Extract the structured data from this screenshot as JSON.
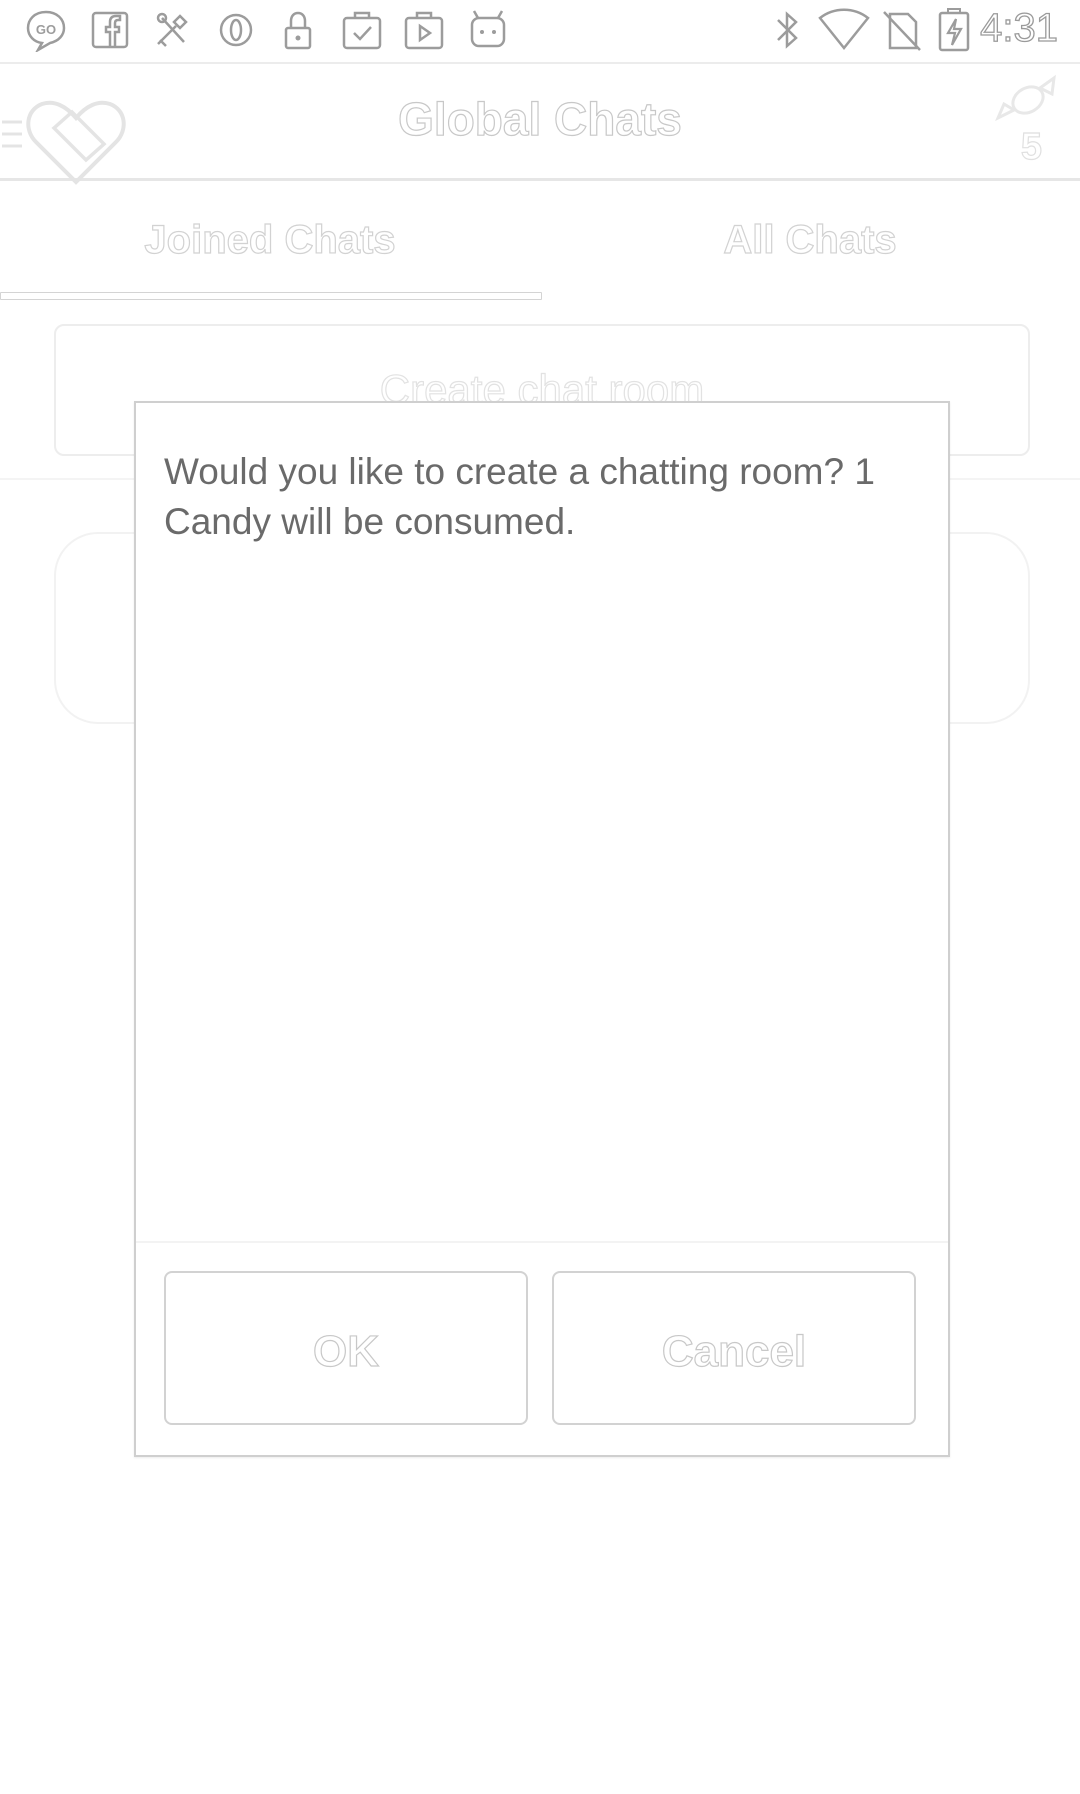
{
  "status_bar": {
    "time": "4:31",
    "left_icons": [
      "go-sms-icon",
      "facebook-icon",
      "tools-icon",
      "opera-icon",
      "lock-icon",
      "clipboard-check-icon",
      "play-bag-icon",
      "android-icon"
    ],
    "right_icons": [
      "bluetooth-icon",
      "wifi-icon",
      "no-sim-icon",
      "battery-charging-icon"
    ]
  },
  "header": {
    "title": "Global Chats",
    "candy_count": "5"
  },
  "tabs": [
    {
      "label": "Joined Chats",
      "selected": true
    },
    {
      "label": "All Chats",
      "selected": false
    }
  ],
  "main": {
    "create_button_label": "Create chat room"
  },
  "dialog": {
    "message": "Would you like to create a chatting room? 1 Candy will be consumed.",
    "ok_label": "OK",
    "cancel_label": "Cancel"
  },
  "colors": {
    "outline": "#c8c8c8",
    "dialog_text": "#6a6a6a",
    "background": "#ffffff"
  }
}
